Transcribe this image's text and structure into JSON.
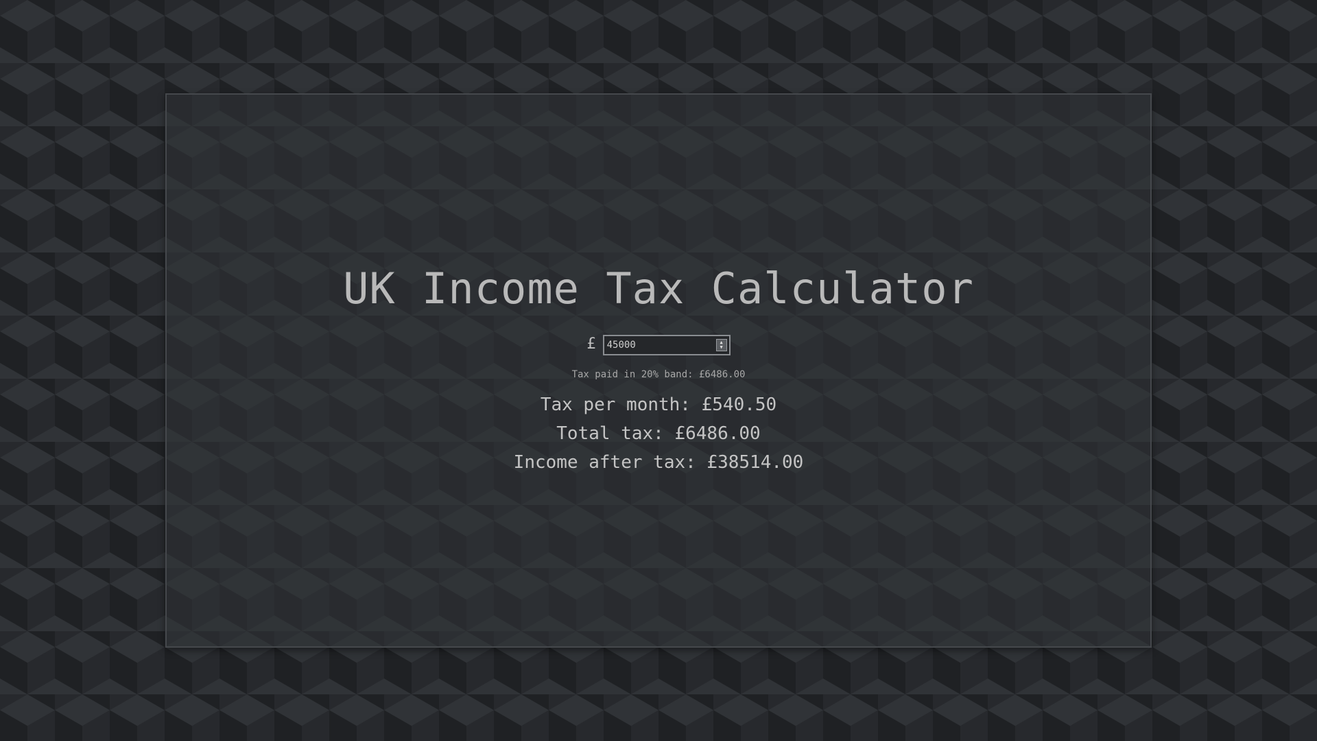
{
  "page": {
    "title": "UK Income Tax Calculator"
  },
  "input": {
    "currency_symbol": "£",
    "value": "45000"
  },
  "results": {
    "band_note": "Tax paid in 20% band: £6486.00",
    "tax_per_month": "Tax per month: £540.50",
    "total_tax": "Total tax: £6486.00",
    "income_after_tax": "Income after tax: £38514.00"
  },
  "colors": {
    "background": "#26282b",
    "panel": "#323539",
    "text": "#c8c8c8"
  }
}
